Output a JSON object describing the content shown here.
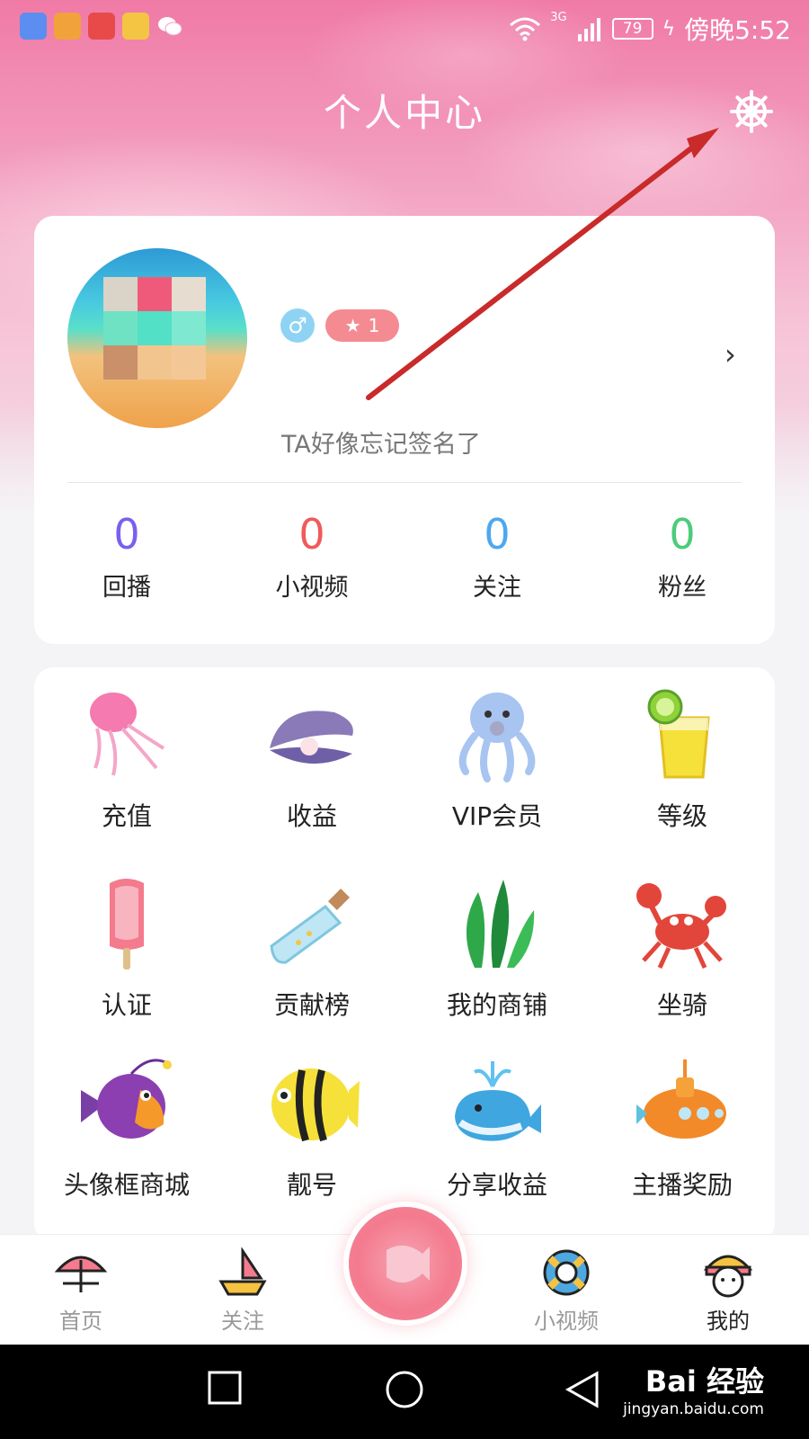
{
  "status_bar": {
    "time": "傍晚5:52",
    "battery": "79",
    "network": "3G"
  },
  "header": {
    "title": "个人中心",
    "settings_icon": "ship-wheel-settings-icon"
  },
  "profile": {
    "gender_symbol": "♂",
    "level": "1",
    "signature": "TA好像忘记签名了"
  },
  "stats": [
    {
      "value": "0",
      "label": "回播",
      "color": "#7b5ff0"
    },
    {
      "value": "0",
      "label": "小视频",
      "color": "#f05a5a"
    },
    {
      "value": "0",
      "label": "关注",
      "color": "#4da8f0"
    },
    {
      "value": "0",
      "label": "粉丝",
      "color": "#4ccc7a"
    }
  ],
  "menu": [
    {
      "label": "充值",
      "icon": "jellyfish-icon"
    },
    {
      "label": "收益",
      "icon": "clam-pearl-icon"
    },
    {
      "label": "VIP会员",
      "icon": "octopus-icon"
    },
    {
      "label": "等级",
      "icon": "lemon-drink-icon"
    },
    {
      "label": "认证",
      "icon": "popsicle-icon"
    },
    {
      "label": "贡献榜",
      "icon": "message-bottle-icon"
    },
    {
      "label": "我的商铺",
      "icon": "seaweed-icon"
    },
    {
      "label": "坐骑",
      "icon": "crab-icon"
    },
    {
      "label": "头像框商城",
      "icon": "anglerfish-icon"
    },
    {
      "label": "靓号",
      "icon": "striped-fish-icon"
    },
    {
      "label": "分享收益",
      "icon": "whale-icon"
    },
    {
      "label": "主播奖励",
      "icon": "submarine-icon"
    }
  ],
  "tabs": [
    {
      "label": "首页",
      "icon": "beach-umbrella-icon"
    },
    {
      "label": "关注",
      "icon": "sailboat-icon"
    },
    {
      "label": "小视频",
      "icon": "lifebuoy-icon"
    },
    {
      "label": "我的",
      "icon": "sailor-avatar-icon"
    }
  ],
  "watermark": {
    "brand": "Bai 经验",
    "url": "jingyan.baidu.com"
  }
}
